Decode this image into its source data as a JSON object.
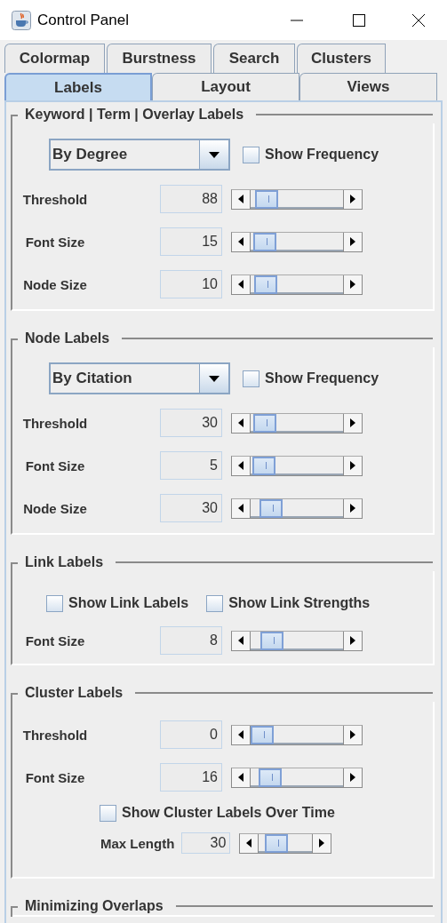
{
  "window": {
    "title": "Control Panel"
  },
  "tab_rows": [
    [
      {
        "label": "Colormap",
        "selected": false
      },
      {
        "label": "Burstness",
        "selected": false
      },
      {
        "label": "Search",
        "selected": false
      },
      {
        "label": "Clusters",
        "selected": false
      }
    ],
    [
      {
        "label": "Labels",
        "selected": true
      },
      {
        "label": "Layout",
        "selected": false
      },
      {
        "label": "Views",
        "selected": false
      }
    ]
  ],
  "sections": [
    {
      "title": "Keyword | Term | Overlay Labels",
      "rows": [
        {
          "kind": "combo",
          "value": "By Degree",
          "checkbox": {
            "label": "Show Frequency",
            "checked": false
          }
        },
        {
          "kind": "slider",
          "label": "Threshold",
          "value": "88",
          "level": 0.06
        },
        {
          "kind": "slider",
          "label": "Font Size",
          "value": "15",
          "level": 0.04
        },
        {
          "kind": "slider",
          "label": "Node Size",
          "value": "10",
          "level": 0.05
        }
      ]
    },
    {
      "title": "Node Labels",
      "rows": [
        {
          "kind": "combo",
          "value": "By Citation",
          "checkbox": {
            "label": "Show Frequency",
            "checked": false
          }
        },
        {
          "kind": "slider",
          "label": "Threshold",
          "value": "30",
          "level": 0.04
        },
        {
          "kind": "slider",
          "label": "Font Size",
          "value": "5",
          "level": 0.03
        },
        {
          "kind": "slider",
          "label": "Node Size",
          "value": "30",
          "level": 0.13
        }
      ]
    },
    {
      "title": "Link Labels",
      "rows": [
        {
          "kind": "checks",
          "items": [
            {
              "label": "Show Link Labels",
              "checked": false
            },
            {
              "label": "Show Link Strengths",
              "checked": false
            }
          ]
        },
        {
          "kind": "slider",
          "label": "Font Size",
          "value": "8",
          "level": 0.14
        }
      ]
    },
    {
      "title": "Cluster Labels",
      "rows": [
        {
          "kind": "slider",
          "label": "Threshold",
          "value": "0",
          "level": 0.0
        },
        {
          "kind": "slider",
          "label": "Font Size",
          "value": "16",
          "level": 0.12
        },
        {
          "kind": "checks",
          "items": [
            {
              "label": "Show Cluster Labels Over Time",
              "checked": false
            }
          ]
        },
        {
          "kind": "inline_slider",
          "label": "Max Length",
          "value": "30",
          "level": 0.2
        }
      ]
    },
    {
      "title": "Minimizing Overlaps"
    }
  ]
}
